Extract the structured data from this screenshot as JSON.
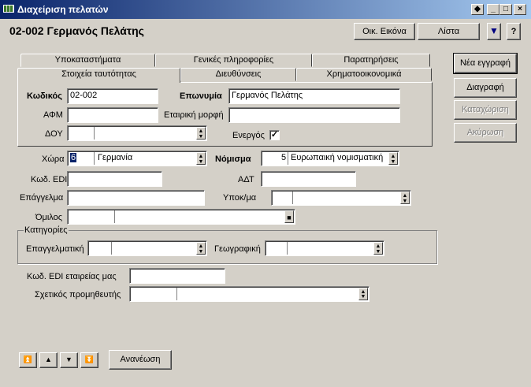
{
  "window": {
    "title": "Διαχείριση πελατών",
    "heading": "02-002 Γερμανός Πελάτης"
  },
  "header_buttons": {
    "family_label": "Οικ. Εικόνα",
    "list_label": "Λίστα",
    "help_label": "?"
  },
  "tabs_back": [
    "Υποκαταστήματα",
    "Γενικές πληροφορίες",
    "Παρατηρήσεις"
  ],
  "tabs_front": [
    "Στοιχεία ταυτότητας",
    "Διευθύνσεις",
    "Χρηματοοικονομικά"
  ],
  "side_buttons": {
    "new": "Νέα εγγραφή",
    "delete": "Διαγραφή",
    "save": "Καταχώριση",
    "cancel": "Ακύρωση"
  },
  "identity": {
    "code_label": "Κωδικός",
    "code_value": "02-002",
    "name_label": "Επωνυμία",
    "name_value": "Γερμανός Πελάτης",
    "afm_label": "ΑΦΜ",
    "afm_value": "",
    "form_label": "Εταιρική μορφή",
    "form_value": "",
    "doy_label": "ΔΟΥ",
    "doy_value": "",
    "active_label": "Ενεργός",
    "active_checked": "✓"
  },
  "fields": {
    "country_label": "Χώρα",
    "country_code": "6",
    "country_name": "Γερμανία",
    "currency_label": "Νόμισμα",
    "currency_code": "5",
    "currency_name": "Ευρωπαική νομισματική",
    "edi_label": "Κωδ. EDI",
    "edi_value": "",
    "adt_label": "ΑΔΤ",
    "adt_value": "",
    "profession_label": "Επάγγελμα",
    "profession_value": "",
    "sub_label": "Υποκ/μα",
    "sub_value": "",
    "group_label": "Όμιλος",
    "group_value": ""
  },
  "categories": {
    "title": "Κατηγορίες",
    "professional_label": "Επαγγελματική",
    "professional_value": "",
    "geographic_label": "Γεωγραφική",
    "geographic_value": ""
  },
  "extra": {
    "company_edi_label": "Κωδ. EDI εταιρείας μας",
    "company_edi_value": "",
    "supplier_label": "Σχετικός προμηθευτής",
    "supplier_value": ""
  },
  "footer": {
    "refresh_label": "Ανανέωση"
  },
  "icons": {
    "first": "first-record-icon",
    "prev": "previous-record-icon",
    "next": "next-record-icon",
    "last": "last-record-icon"
  }
}
